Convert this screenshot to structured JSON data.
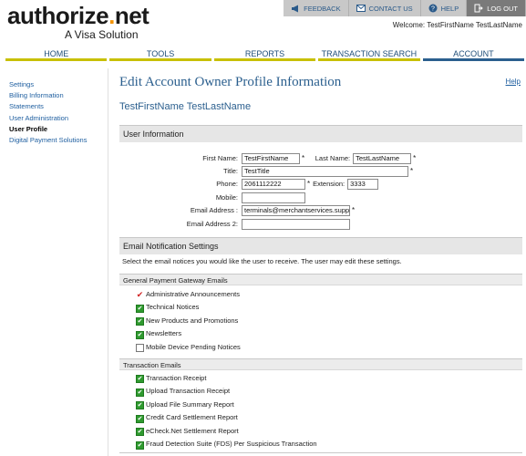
{
  "logo": {
    "brand_main": "authorize",
    "brand_dot": ".",
    "brand_tld": "net",
    "tagline": "A Visa Solution"
  },
  "topbar": [
    {
      "label": "FEEDBACK",
      "icon": "megaphone-icon"
    },
    {
      "label": "CONTACT US",
      "icon": "envelope-icon"
    },
    {
      "label": "HELP",
      "icon": "help-icon"
    },
    {
      "label": "LOG OUT",
      "icon": "logout-icon"
    }
  ],
  "welcome": "Welcome: TestFirstName TestLastName",
  "nav": [
    "HOME",
    "TOOLS",
    "REPORTS",
    "TRANSACTION SEARCH",
    "ACCOUNT"
  ],
  "sidebar": [
    "Settings",
    "Billing Information",
    "Statements",
    "User Administration",
    "User Profile",
    "Digital Payment Solutions"
  ],
  "page": {
    "title": "Edit Account Owner Profile Information",
    "help": "Help",
    "user_name": "TestFirstName TestLastName"
  },
  "user_info": {
    "heading": "User Information",
    "first_name_label": "First Name:",
    "first_name": "TestFirstName",
    "last_name_label": "Last Name:",
    "last_name": "TestLastName",
    "title_label": "Title:",
    "title": "TestTitle",
    "phone_label": "Phone:",
    "phone": "2061112222",
    "extension_label": "Extension:",
    "extension": "3333",
    "mobile_label": "Mobile:",
    "mobile": "",
    "email_label": "Email Address :",
    "email": "terminals@merchantservices.suppo",
    "email2_label": "Email Address 2:",
    "email2": "",
    "required": "*"
  },
  "email_settings": {
    "heading": "Email Notification Settings",
    "note": "Select the email notices you would like the user to receive. The user may edit these settings.",
    "groups": [
      {
        "title": "General Payment Gateway Emails",
        "items": [
          {
            "label": "Administrative Announcements",
            "state": "required"
          },
          {
            "label": "Technical Notices",
            "state": "checked"
          },
          {
            "label": "New Products and Promotions",
            "state": "checked"
          },
          {
            "label": "Newsletters",
            "state": "checked"
          },
          {
            "label": "Mobile Device Pending Notices",
            "state": "unchecked"
          }
        ]
      },
      {
        "title": "Transaction Emails",
        "items": [
          {
            "label": "Transaction Receipt",
            "state": "checked"
          },
          {
            "label": "Upload Transaction Receipt",
            "state": "checked"
          },
          {
            "label": "Upload File Summary Report",
            "state": "checked"
          },
          {
            "label": "Credit Card Settlement Report",
            "state": "checked"
          },
          {
            "label": "eCheck.Net Settlement Report",
            "state": "checked"
          },
          {
            "label": "Fraud Detection Suite (FDS) Per Suspicious Transaction",
            "state": "checked"
          }
        ]
      }
    ]
  },
  "colors": {
    "link": "#1f5fa0",
    "title": "#2b5f8e",
    "nav_underline": "#c8c000",
    "check_green": "#2f9a2f",
    "check_red": "#d02020"
  }
}
